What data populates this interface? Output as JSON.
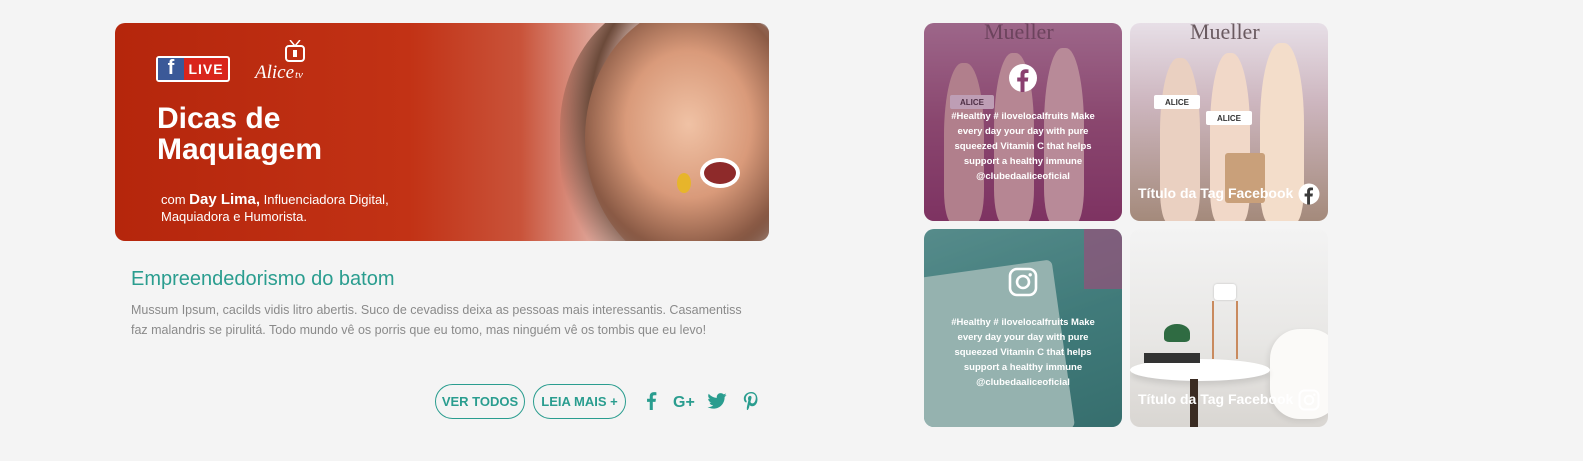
{
  "banner": {
    "live_label": "LIVE",
    "fb_letter": "f",
    "brand_logo": "Alice tv",
    "title_line1": "Dicas de",
    "title_line2": "Maquiagem",
    "sub_prefix": "com ",
    "sub_name": "Day Lima,",
    "sub_rest": " Influenciadora Digital,",
    "sub_line2": "Maquiadora e Humorista."
  },
  "article": {
    "title": "Empreendedorismo do batom",
    "body": "Mussum Ipsum, cacilds vidis litro abertis. Suco de cevadiss deixa as pessoas mais interessantis. Casamentiss faz malandris se pirulitá. Todo mundo vê os porris que eu tomo, mas ninguém vê os tombis que eu levo!",
    "buttons": {
      "view_all": "VER TODOS",
      "read_more": "LEIA MAIS +"
    },
    "social_icons": [
      "facebook-icon",
      "google-plus-icon",
      "twitter-icon",
      "pinterest-icon"
    ]
  },
  "tiles": [
    {
      "kind": "facebook-hover",
      "photo_brand": "Mueller",
      "photo_signs": [
        "ALICE",
        "ALICE"
      ],
      "text": "#Healthy # ilovelocalfruits Make every day your day with pure squeezed Vitamin C that helps support a healthy immune @clubedaaliceoficial"
    },
    {
      "kind": "facebook",
      "photo_brand": "Mueller",
      "photo_signs": [
        "ALICE",
        "ALICE"
      ],
      "caption": "Título da Tag Facebook"
    },
    {
      "kind": "instagram-hover",
      "text": "#Healthy # ilovelocalfruits Make every day your day with pure squeezed Vitamin C that helps support a healthy immune @clubedaaliceoficial"
    },
    {
      "kind": "instagram",
      "caption": "Título da Tag Facebook"
    }
  ],
  "colors": {
    "accent": "#2a9d8f",
    "banner_red": "#b5260c",
    "background": "#f4f4f4"
  }
}
